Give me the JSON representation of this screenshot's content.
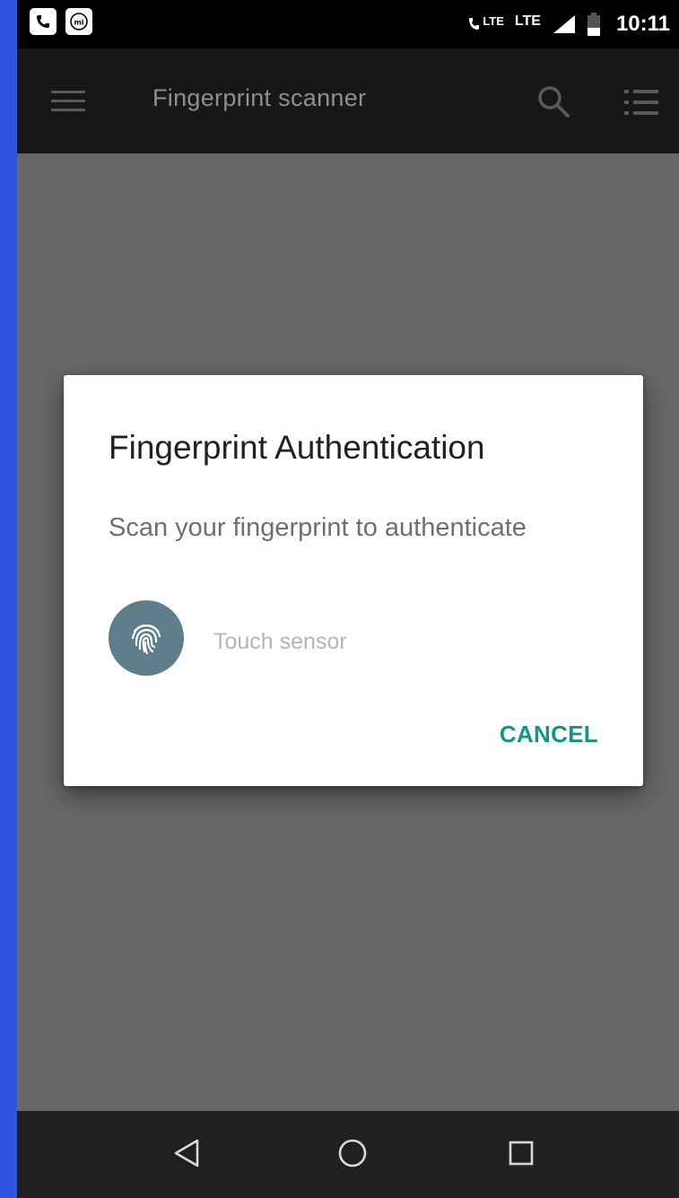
{
  "status_bar": {
    "network_labels": [
      "LTE",
      "LTE"
    ],
    "time": "10:11",
    "icons": [
      "call-icon",
      "mi-app-icon",
      "volte-icon",
      "signal-icon",
      "battery-icon"
    ]
  },
  "app_bar": {
    "title": "Fingerprint scanner",
    "icons": [
      "menu-icon",
      "search-icon",
      "list-icon"
    ]
  },
  "dialog": {
    "title": "Fingerprint Authentication",
    "description": "Scan your fingerprint to authenticate",
    "status_text": "Touch sensor",
    "cancel_label": "CANCEL",
    "fingerprint_circle_color": "#607d8b",
    "accent_color": "#129689"
  },
  "nav_bar": {
    "icons": [
      "back-icon",
      "home-icon",
      "recents-icon"
    ]
  }
}
